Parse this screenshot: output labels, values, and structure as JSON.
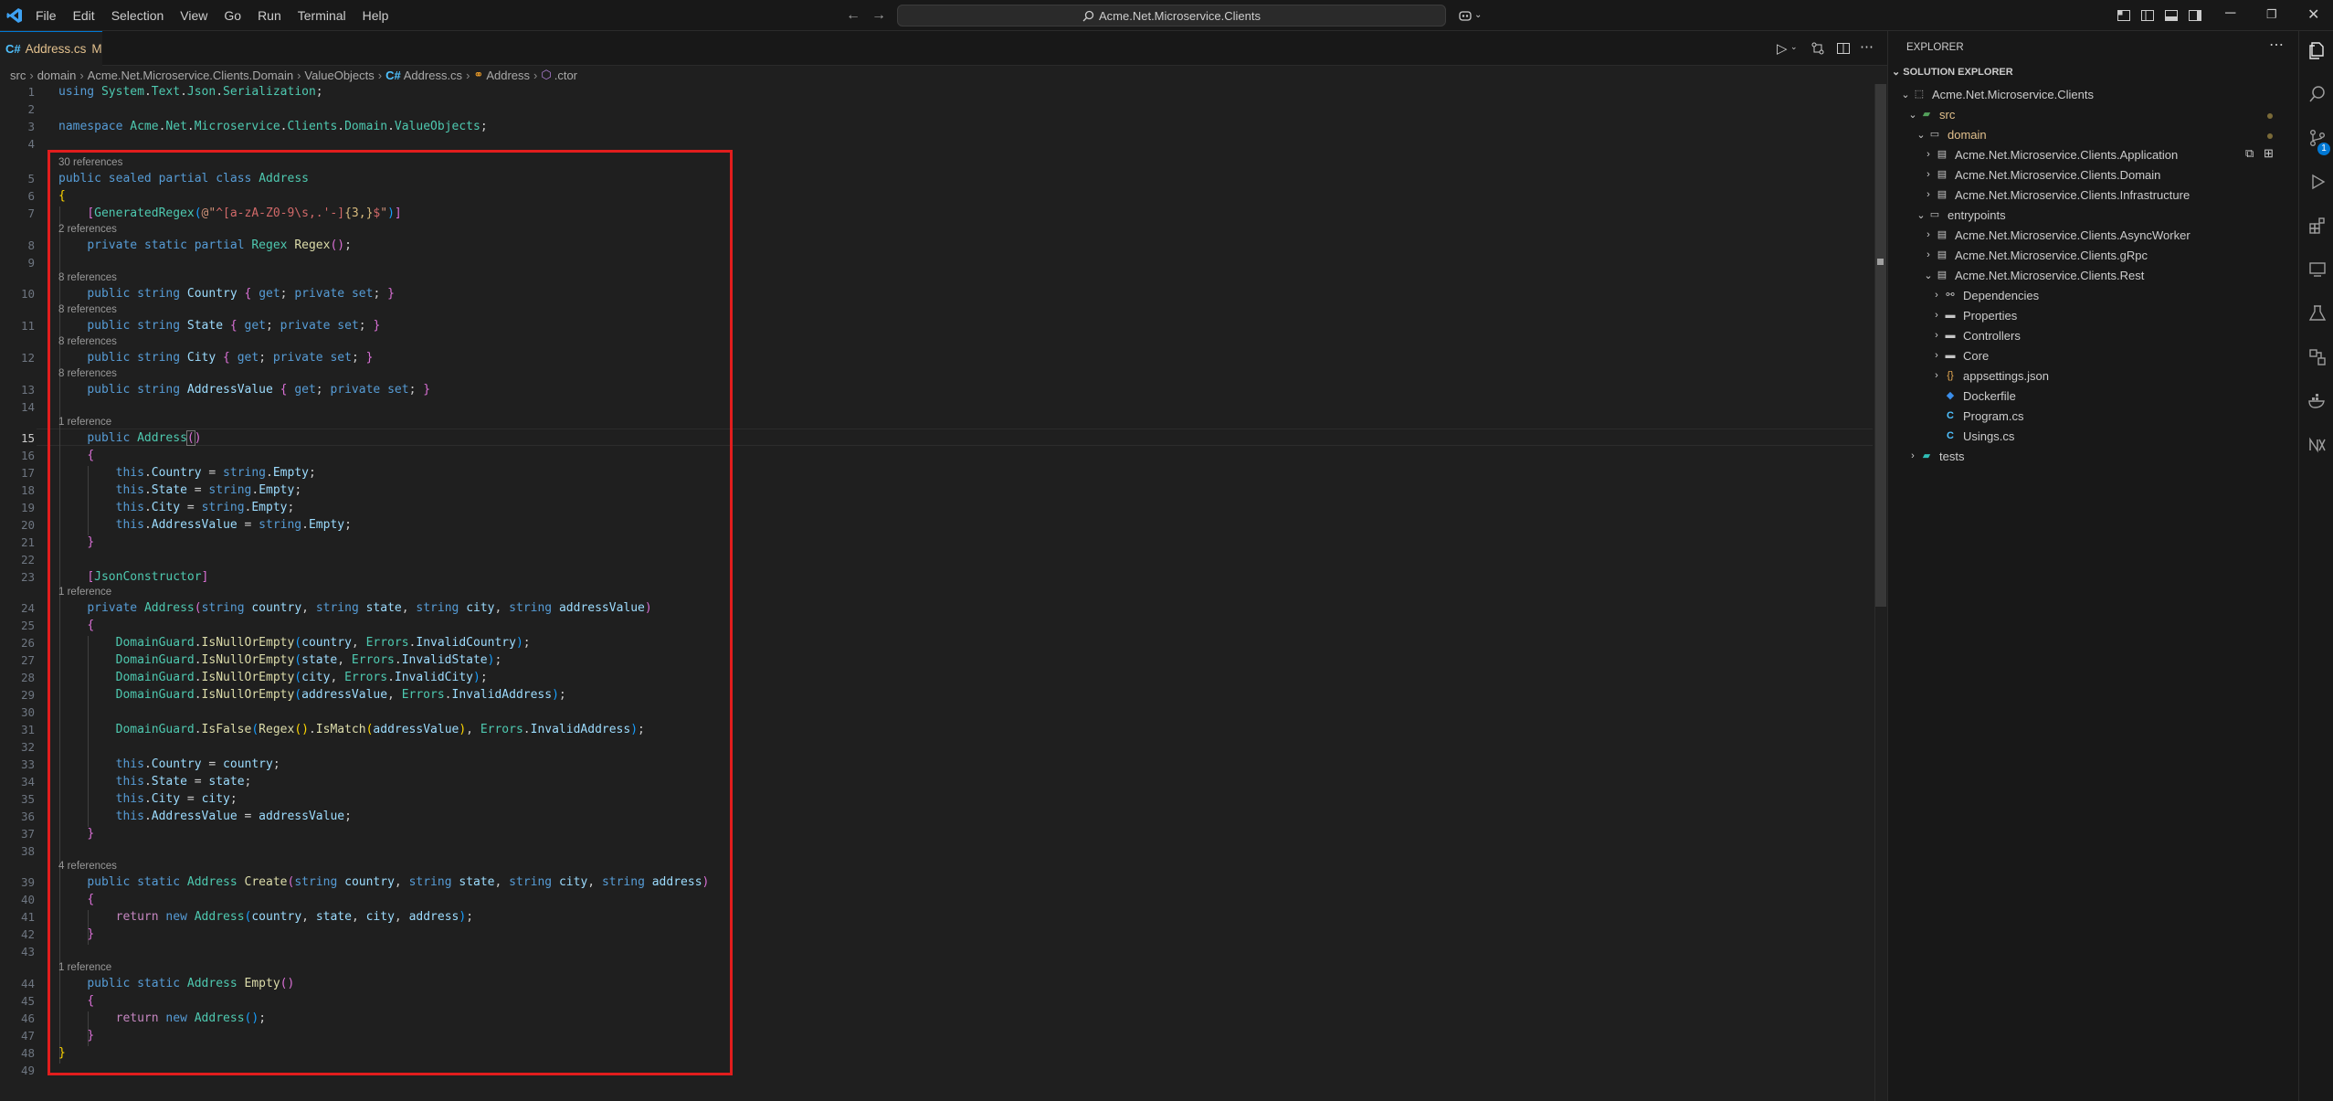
{
  "menu": [
    "File",
    "Edit",
    "Selection",
    "View",
    "Go",
    "Run",
    "Terminal",
    "Help"
  ],
  "command_center": "Acme.Net.Microservice.Clients",
  "tab": {
    "icon": "C#",
    "name": "Address.cs",
    "modified": "M"
  },
  "breadcrumb": [
    "src",
    "domain",
    "Acme.Net.Microservice.Clients.Domain",
    "ValueObjects",
    "Address.cs",
    "Address",
    ".ctor"
  ],
  "gutter": [
    "1",
    "2",
    "3",
    "4",
    "5",
    "6",
    "7",
    "8",
    "9",
    "10",
    "11",
    "12",
    "13",
    "14",
    "15",
    "16",
    "17",
    "18",
    "19",
    "20",
    "21",
    "22",
    "23",
    "24",
    "25",
    "26",
    "27",
    "28",
    "29",
    "30",
    "31",
    "32",
    "33",
    "34",
    "35",
    "36",
    "37",
    "38",
    "39",
    "40",
    "41",
    "42",
    "43",
    "44",
    "45",
    "46",
    "47",
    "48",
    "49"
  ],
  "current_line": "15",
  "code_lenses": {
    "l5": "30 references",
    "l8": "2 references",
    "l10": "8 references",
    "l11": "8 references",
    "l12": "8 references",
    "l13": "8 references",
    "l15": "1 reference",
    "l24": "1 reference",
    "l39": "4 references",
    "l44": "1 reference"
  },
  "explorer": {
    "header": "EXPLORER",
    "section": "SOLUTION EXPLORER",
    "items": [
      "Acme.Net.Microservice.Clients",
      "src",
      "domain",
      "Acme.Net.Microservice.Clients.Application",
      "Acme.Net.Microservice.Clients.Domain",
      "Acme.Net.Microservice.Clients.Infrastructure",
      "entrypoints",
      "Acme.Net.Microservice.Clients.AsyncWorker",
      "Acme.Net.Microservice.Clients.gRpc",
      "Acme.Net.Microservice.Clients.Rest",
      "Dependencies",
      "Properties",
      "Controllers",
      "Core",
      "appsettings.json",
      "Dockerfile",
      "Program.cs",
      "Usings.cs",
      "tests"
    ]
  },
  "badge_source_control": "1",
  "colors": {
    "accent": "#0078d4",
    "highlight_box": "#e11d1d",
    "modified": "#e2c08d",
    "folder_src": "#e2c08d"
  }
}
